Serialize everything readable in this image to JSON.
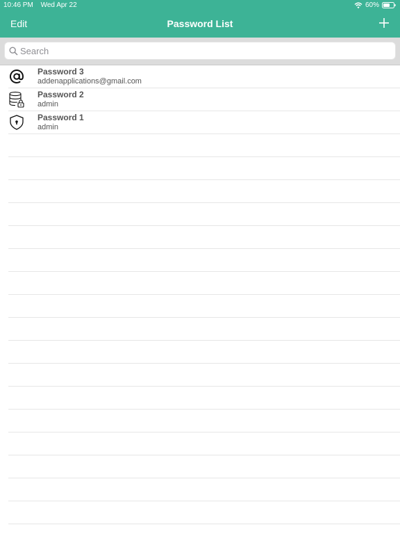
{
  "status_bar": {
    "time": "10:46 PM",
    "date": "Wed Apr 22",
    "battery": "60%"
  },
  "nav": {
    "edit_label": "Edit",
    "title": "Password List",
    "add_icon": "plus-icon"
  },
  "search": {
    "placeholder": "Search",
    "value": ""
  },
  "passwords": [
    {
      "title": "Password 3",
      "subtitle": "addenapplications@gmail.com",
      "icon": "at-sign-icon"
    },
    {
      "title": "Password 2",
      "subtitle": "admin",
      "icon": "database-lock-icon"
    },
    {
      "title": "Password 1",
      "subtitle": "admin",
      "icon": "shield-lock-icon"
    }
  ],
  "colors": {
    "header": "#3db396",
    "search_bg": "#dcdcdc"
  }
}
